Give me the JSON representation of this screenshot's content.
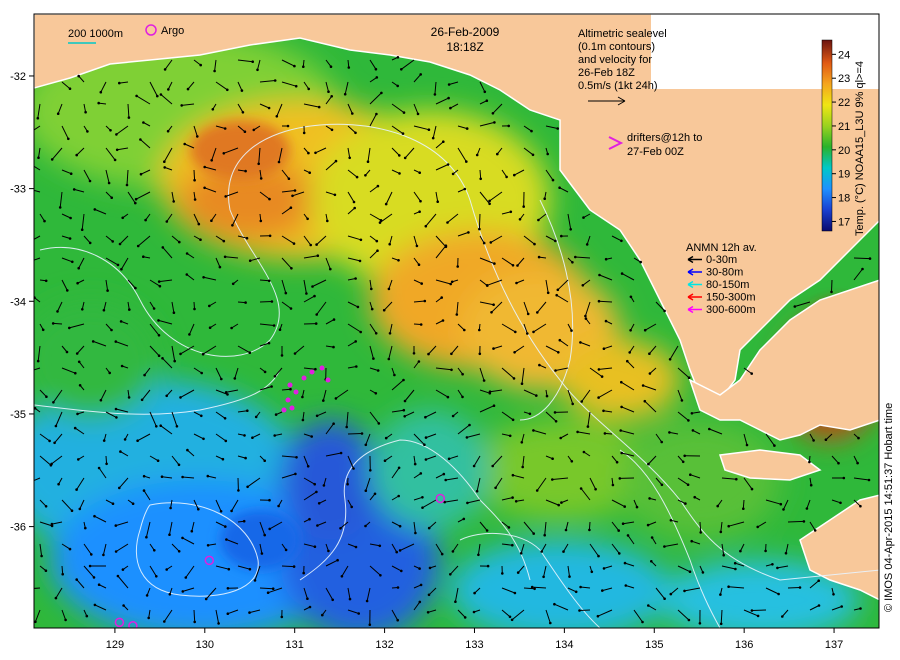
{
  "title": {
    "date": "26-Feb-2009",
    "time": "18:18Z"
  },
  "legend_top_left": {
    "depth_label": "200  1000m",
    "argo_label": "Argo"
  },
  "altimetry_note": {
    "lines": [
      "Altimetric sealevel",
      "(0.1m contours)",
      "and velocity for",
      "26-Feb 18Z",
      "0.5m/s (1kt 24h)"
    ]
  },
  "drifters_note": {
    "lines": [
      "drifters@12h to",
      "27-Feb 00Z"
    ],
    "marker": ">"
  },
  "anmn_legend": {
    "title": "ANMN 12h av.",
    "items": [
      {
        "label": "0-30m",
        "color": "#000000"
      },
      {
        "label": "30-80m",
        "color": "#0000ff"
      },
      {
        "label": "80-150m",
        "color": "#00e5e5"
      },
      {
        "label": "150-300m",
        "color": "#ff0000"
      },
      {
        "label": "300-600m",
        "color": "#ff00ff"
      }
    ]
  },
  "colorbar": {
    "title": "Temp. (°C) NOAA15_L3U  9%  ql>=4",
    "ticks": [
      "17",
      "18",
      "19",
      "20",
      "21",
      "22",
      "23",
      "24"
    ],
    "range": [
      16.6,
      24.6
    ],
    "colors": [
      "#0a0a6e",
      "#1a3fd0",
      "#1e90ff",
      "#00c8c8",
      "#2ab22a",
      "#9ad21e",
      "#f0e614",
      "#f5a51e",
      "#e05a14",
      "#6b1410"
    ]
  },
  "credit": "© IMOS 04-Apr-2015 14:51:37 Hobart time",
  "axes": {
    "lon_ticks": [
      "129",
      "130",
      "131",
      "132",
      "133",
      "134",
      "135",
      "136",
      "137"
    ],
    "lat_ticks": [
      "-32",
      "-33",
      "-34",
      "-35",
      "-36"
    ],
    "lon_range": [
      128.1,
      137.5
    ],
    "lat_range": [
      -36.9,
      -31.45
    ]
  },
  "argo_floats": [
    {
      "lon": 132.62,
      "lat": -35.75
    },
    {
      "lon": 130.05,
      "lat": -36.3
    },
    {
      "lon": 129.05,
      "lat": -36.85
    },
    {
      "lon": 129.2,
      "lat": -36.88
    }
  ],
  "colors": {
    "land": "#f8c89a",
    "coast": "#ffffff",
    "contour": "#e8f4ff",
    "argo": "#e020e0",
    "drifter": "#e020e0",
    "arrow": "#000000"
  }
}
